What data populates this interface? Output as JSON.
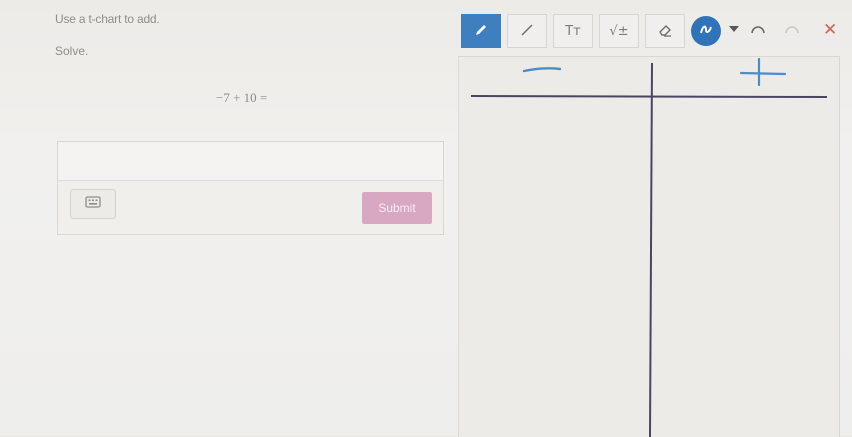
{
  "question": {
    "prompt": "Use a t-chart to add.",
    "instruction": "Solve.",
    "equation": "−7 + 10 ="
  },
  "answer": {
    "input_value": "",
    "submit_label": "Submit"
  },
  "toolbar": {
    "tools": [
      {
        "name": "pen",
        "active": true
      },
      {
        "name": "line",
        "active": false
      },
      {
        "name": "text",
        "label": "Tт",
        "active": false
      },
      {
        "name": "math",
        "label": "√±",
        "active": false
      },
      {
        "name": "eraser",
        "active": false
      }
    ],
    "color_selected": "#2f74b8",
    "close_color": "#d2615b"
  },
  "drawing": {
    "left_header": "−",
    "right_header": "+"
  }
}
